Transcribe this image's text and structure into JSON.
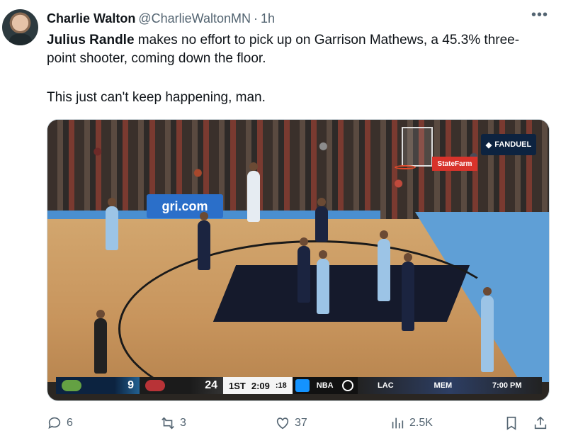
{
  "author": {
    "name": "Charlie Walton",
    "handle": "@CharlieWaltonMN",
    "separator": "·",
    "time": "1h"
  },
  "tweet": {
    "mention": "Julius Randle",
    "line1_rest": " makes no effort to pick up on Garrison Mathews, a 45.3% three-point shooter, coming down the floor.",
    "line2": "This just can't keep happening, man."
  },
  "video": {
    "ad_board": "gri.com",
    "statefarm": "StateFarm",
    "fanduel": "FANDUEL",
    "scoreboard": {
      "home_score": "9",
      "away_score": "24",
      "period": "1ST",
      "clock": "2:09",
      "shot_clock": ":18",
      "league": "NBA",
      "matchup_left": "LAC",
      "matchup_right": "MEM",
      "matchup_time": "7:00 PM"
    }
  },
  "actions": {
    "replies": "6",
    "reposts": "3",
    "likes": "37",
    "views": "2.5K"
  },
  "icons": [
    "more-icon",
    "reply-icon",
    "repost-icon",
    "like-icon",
    "views-icon",
    "bookmark-icon",
    "share-icon"
  ],
  "colors": {
    "text": "#0f1419",
    "muted": "#536471",
    "border": "#cfd9de"
  }
}
